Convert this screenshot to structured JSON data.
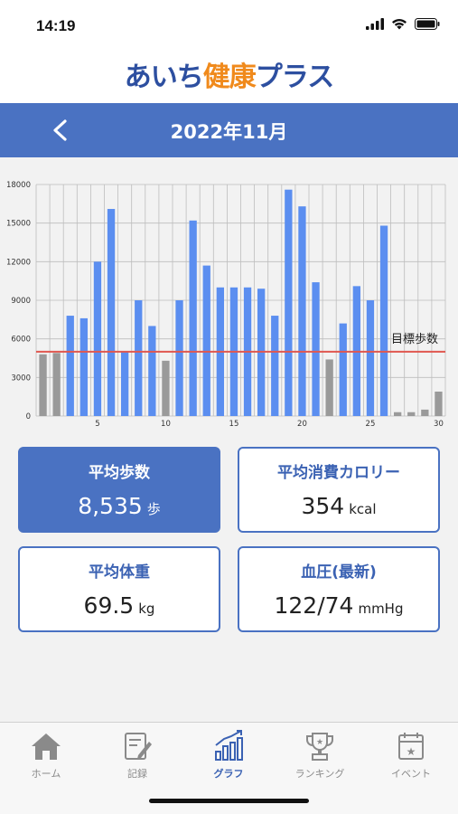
{
  "status": {
    "time": "14:19"
  },
  "app": {
    "logo_part1": "あいち",
    "logo_part2": "健康",
    "logo_part3": "プラス"
  },
  "header": {
    "month_title": "2022年11月"
  },
  "colors": {
    "brand_blue": "#4a72c2",
    "bar_blue": "#5b8ef0",
    "bar_gray": "#9a9a9a",
    "target_red": "#e0574f",
    "logo_orange": "#f08a1c"
  },
  "chart_data": {
    "type": "bar",
    "categories": [
      1,
      2,
      3,
      4,
      5,
      6,
      7,
      8,
      9,
      10,
      11,
      12,
      13,
      14,
      15,
      16,
      17,
      18,
      19,
      20,
      21,
      22,
      23,
      24,
      25,
      26,
      27,
      28,
      29,
      30
    ],
    "values": [
      4800,
      4900,
      7800,
      7600,
      12000,
      16100,
      5000,
      9000,
      7000,
      4300,
      9000,
      15200,
      11700,
      10000,
      10000,
      10000,
      9900,
      7800,
      17600,
      16300,
      10400,
      4400,
      7200,
      10100,
      9000,
      14800,
      300,
      300,
      500,
      1900
    ],
    "below_target_gray": [
      true,
      true,
      false,
      false,
      false,
      false,
      false,
      false,
      false,
      true,
      false,
      false,
      false,
      false,
      false,
      false,
      false,
      false,
      false,
      false,
      false,
      true,
      false,
      false,
      false,
      false,
      true,
      true,
      true,
      true
    ],
    "ylim": [
      0,
      18000
    ],
    "yticks": [
      "0",
      "3000",
      "6000",
      "9000",
      "12000",
      "15000",
      "18000"
    ],
    "xticks": [
      "5",
      "10",
      "15",
      "20",
      "25",
      "30"
    ],
    "target_value": 5000,
    "target_label": "目標歩数",
    "grid": true
  },
  "cards": {
    "steps": {
      "title": "平均歩数",
      "value": "8,535",
      "unit": "歩"
    },
    "calories": {
      "title": "平均消費カロリー",
      "value": "354",
      "unit": "kcal"
    },
    "weight": {
      "title": "平均体重",
      "value": "69.5",
      "unit": "kg"
    },
    "pressure": {
      "title": "血圧(最新)",
      "value": "122/74",
      "unit": "mmHg"
    }
  },
  "tabs": [
    {
      "label": "ホーム",
      "icon": "home-icon"
    },
    {
      "label": "記録",
      "icon": "record-icon"
    },
    {
      "label": "グラフ",
      "icon": "graph-icon"
    },
    {
      "label": "ランキング",
      "icon": "trophy-icon"
    },
    {
      "label": "イベント",
      "icon": "calendar-icon"
    }
  ]
}
